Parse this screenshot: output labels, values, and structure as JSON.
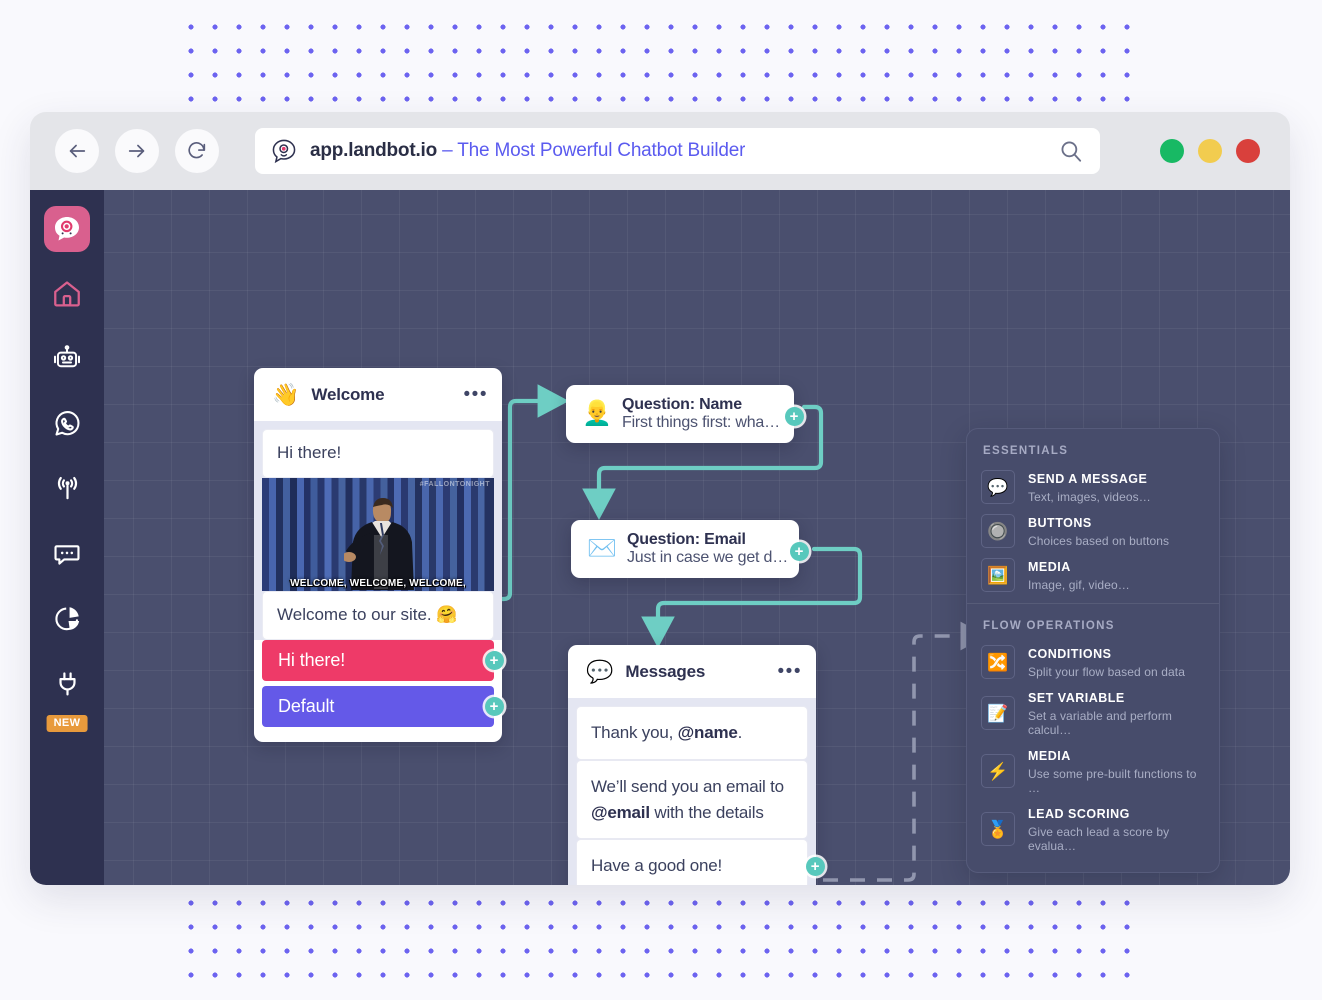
{
  "browser": {
    "back_icon": "arrow-left-icon",
    "forward_icon": "arrow-right-icon",
    "reload_icon": "reload-icon",
    "favicon": "landbot-logo-icon",
    "url_domain": "app.landbot.io",
    "url_title": "– The Most Powerful Chatbot Builder",
    "search_icon": "search-icon",
    "traffic_lights": [
      {
        "name": "maximize-button",
        "color": "#18B964"
      },
      {
        "name": "minimize-button",
        "color": "#F2CC4F"
      },
      {
        "name": "close-button",
        "color": "#D9403C"
      }
    ]
  },
  "sidebar": {
    "items": [
      {
        "name": "logo",
        "icon": "landbot-logo-icon"
      },
      {
        "name": "home",
        "icon": "home-icon"
      },
      {
        "name": "bots",
        "icon": "robot-icon"
      },
      {
        "name": "whatsapp",
        "icon": "whatsapp-icon"
      },
      {
        "name": "broadcast",
        "icon": "antenna-icon"
      },
      {
        "name": "inbox",
        "icon": "chat-bubble-icon"
      },
      {
        "name": "analytics",
        "icon": "pie-chart-icon"
      },
      {
        "name": "integrations",
        "icon": "plug-icon"
      }
    ],
    "badge": "NEW"
  },
  "flow": {
    "welcome": {
      "emoji": "👋",
      "title": "Welcome",
      "more_icon": "more-options-icon",
      "bubble_1": "Hi there!",
      "gif_tag": "#FALLONTONIGHT",
      "gif_caption": "WELCOME, WELCOME, WELCOME,",
      "bubble_2": "Welcome to our site. 🤗",
      "buttons": [
        {
          "label": "Hi there!",
          "color": "#EE3A68"
        },
        {
          "label": "Default",
          "color": "#6459E8"
        }
      ]
    },
    "question_name": {
      "emoji": "👱‍♂️",
      "title": "Question: Name",
      "subtitle": "First things first: wha…"
    },
    "question_email": {
      "emoji": "✉️",
      "title": "Question: Email",
      "subtitle": "Just in case we get d…"
    },
    "messages": {
      "emoji": "💬",
      "title": "Messages",
      "more_icon": "more-options-icon",
      "bubbles": [
        "Thank you, @name.",
        "We’ll send you an email to @email with the details",
        "Have a good one!"
      ]
    },
    "connector_color": "#6ECEC4",
    "dashed_color": "#9196AE",
    "plus_label": "+"
  },
  "library": {
    "sections": [
      {
        "title": "ESSENTIALS",
        "items": [
          {
            "name": "SEND A MESSAGE",
            "desc": "Text, images, videos…",
            "icon": "speech-bubble-icon"
          },
          {
            "name": "BUTTONS",
            "desc": "Choices based on buttons",
            "icon": "button-icon"
          },
          {
            "name": "MEDIA",
            "desc": "Image, gif, video…",
            "icon": "picture-icon"
          }
        ]
      },
      {
        "title": "FLOW OPERATIONS",
        "items": [
          {
            "name": "CONDITIONS",
            "desc": "Split your flow based on data",
            "icon": "shuffle-icon"
          },
          {
            "name": "SET VARIABLE",
            "desc": "Set a variable and perform calcul…",
            "icon": "memo-icon"
          },
          {
            "name": "MEDIA",
            "desc": "Use some pre-built functions to …",
            "icon": "lightning-icon"
          },
          {
            "name": "LEAD SCORING",
            "desc": "Give each lead a score by evalua…",
            "icon": "medal-icon"
          }
        ]
      }
    ]
  },
  "theme": {
    "page_bg": "#F9F9FD",
    "dot_color": "#6C63F0",
    "canvas_bg": "#4A4F6E",
    "sidebar_bg": "#2E3150",
    "accent_teal": "#57C8BC",
    "accent_pink": "#D9608E",
    "badge_orange": "#E89A3C"
  }
}
